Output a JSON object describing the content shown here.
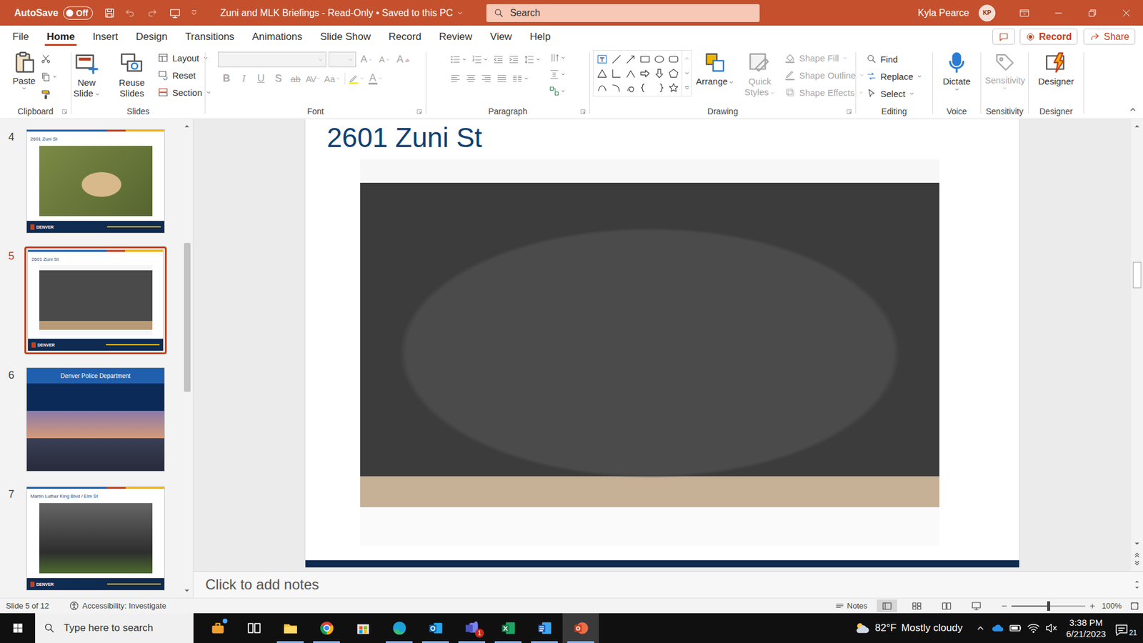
{
  "window": {
    "autosave_label": "AutoSave",
    "autosave_state": "Off",
    "autosave_on": false,
    "title": "Zuni and MLK Briefings - Read-Only • Saved to this PC",
    "search": {
      "placeholder": "Search"
    },
    "user": "Kyla Pearce",
    "initials": "KP"
  },
  "menu": {
    "tabs": [
      {
        "label": "File",
        "selected": false
      },
      {
        "label": "Home",
        "selected": true
      },
      {
        "label": "Insert",
        "selected": false
      },
      {
        "label": "Design",
        "selected": false
      },
      {
        "label": "Transitions",
        "selected": false
      },
      {
        "label": "Animations",
        "selected": false
      },
      {
        "label": "Slide Show",
        "selected": false
      },
      {
        "label": "Record",
        "selected": false
      },
      {
        "label": "Review",
        "selected": false
      },
      {
        "label": "View",
        "selected": false
      },
      {
        "label": "Help",
        "selected": false
      }
    ],
    "record": "Record",
    "share": "Share"
  },
  "ribbon": {
    "clipboard": {
      "label": "Clipboard",
      "paste": "Paste"
    },
    "slides": {
      "label": "Slides",
      "new_slide": "New Slide",
      "reuse_slides": "Reuse Slides",
      "layout": "Layout",
      "reset": "Reset",
      "section": "Section"
    },
    "font": {
      "label": "Font",
      "disabled": true,
      "grow": "A",
      "shrink": "A",
      "clear": "A",
      "styles": [
        {
          "text": "B",
          "kind": "bold"
        },
        {
          "text": "I",
          "kind": "italic"
        },
        {
          "text": "U",
          "kind": "underline"
        },
        {
          "text": "S",
          "kind": "shadow"
        },
        {
          "text": "ab",
          "kind": "strike"
        },
        {
          "text": "AV",
          "kind": "spacing"
        },
        {
          "text": "Aa",
          "kind": "case"
        }
      ],
      "color": "A"
    },
    "paragraph": {
      "label": "Paragraph",
      "disabled": true
    },
    "drawing": {
      "label": "Drawing",
      "arrange": "Arrange",
      "quick_styles": "Quick Styles",
      "shape_fill": "Shape Fill",
      "shape_outline": "Shape Outline",
      "shape_effects": "Shape Effects",
      "styles_disabled": true
    },
    "editing": {
      "label": "Editing",
      "find": "Find",
      "replace": "Replace",
      "select": "Select"
    },
    "voice": {
      "label": "Voice",
      "dictate": "Dictate"
    },
    "sensitivity": {
      "label": "Sensitivity",
      "button": "Sensitivity",
      "disabled": true
    },
    "designer": {
      "label": "Designer",
      "button": "Designer"
    }
  },
  "thumbnails": {
    "items": [
      {
        "number": "4",
        "title": "2601 Zuni St",
        "kind": "outdoor",
        "selected": false,
        "footer": "DENVER"
      },
      {
        "number": "5",
        "title": "2601 Zuni St",
        "kind": "studio",
        "selected": true,
        "footer": "DENVER"
      },
      {
        "number": "6",
        "title": "Denver Police Department",
        "kind": "cover",
        "selected": false
      },
      {
        "number": "7",
        "title": "Martin Luther King Blvd / Elm St",
        "kind": "scene",
        "selected": false,
        "footer": "DENVER"
      }
    ]
  },
  "slide": {
    "title": "2601 Zuni St"
  },
  "notes": {
    "placeholder": "Click to add notes"
  },
  "status_bar": {
    "slide": "Slide 5 of 12",
    "accessibility": "Accessibility: Investigate",
    "notes": "Notes",
    "views": [
      {
        "kind": "normal",
        "selected": true
      },
      {
        "kind": "sorter",
        "selected": false
      },
      {
        "kind": "reading",
        "selected": false
      },
      {
        "kind": "slideshow",
        "selected": false
      }
    ],
    "zoom": "100%",
    "zoom_level": 0.5
  },
  "taskbar": {
    "search": {
      "placeholder": "Type here to search"
    },
    "apps": [
      {
        "kind": "news",
        "running": false,
        "active": false,
        "dot": true,
        "badge": ""
      },
      {
        "kind": "taskview",
        "running": false,
        "active": false,
        "dot": false,
        "badge": ""
      },
      {
        "kind": "explorer",
        "running": true,
        "active": false,
        "dot": false,
        "badge": ""
      },
      {
        "kind": "chrome",
        "running": true,
        "active": false,
        "dot": false,
        "badge": ""
      },
      {
        "kind": "store",
        "running": false,
        "active": false,
        "dot": false,
        "badge": ""
      },
      {
        "kind": "edge",
        "running": true,
        "active": false,
        "dot": false,
        "badge": ""
      },
      {
        "kind": "outlook",
        "running": true,
        "active": false,
        "dot": false,
        "badge": ""
      },
      {
        "kind": "teams",
        "running": true,
        "active": false,
        "dot": false,
        "badge": "1"
      },
      {
        "kind": "excel",
        "running": true,
        "active": false,
        "dot": false,
        "badge": ""
      },
      {
        "kind": "word",
        "running": true,
        "active": false,
        "dot": false,
        "badge": ""
      },
      {
        "kind": "powerpoint",
        "running": true,
        "active": true,
        "dot": false,
        "badge": ""
      }
    ],
    "weather": {
      "temp": "82°F",
      "condition": "Mostly cloudy"
    },
    "time": "3:38 PM",
    "date": "6/21/2023",
    "notifications": "21"
  }
}
